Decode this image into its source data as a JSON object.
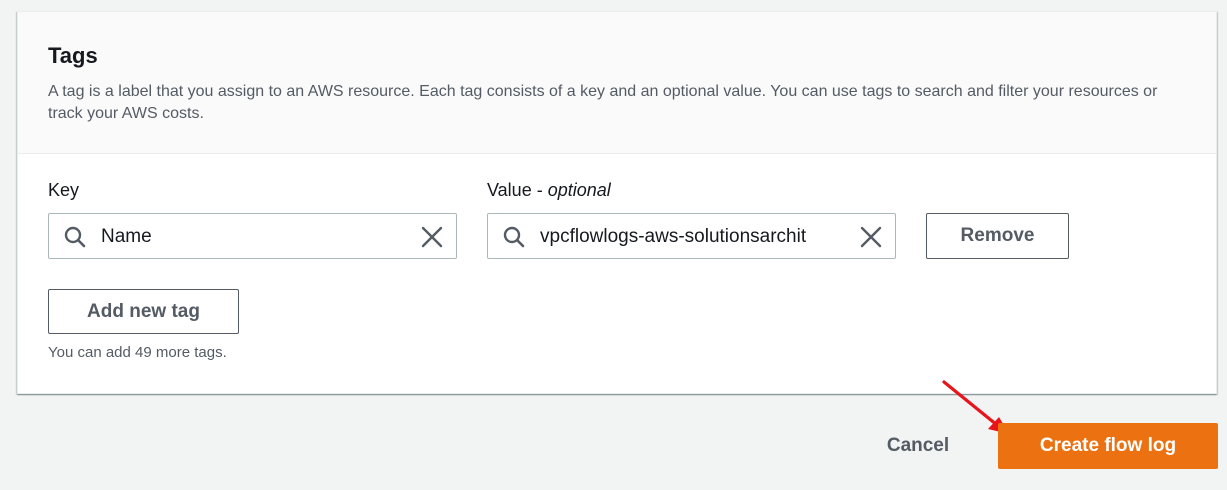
{
  "tags_section": {
    "title": "Tags",
    "description": "A tag is a label that you assign to an AWS resource. Each tag consists of a key and an optional value. You can use tags to search and filter your resources or track your AWS costs."
  },
  "tag_row": {
    "key_label": "Key",
    "value_label_main": "Value - ",
    "value_label_optional": "optional",
    "key_value": "Name",
    "value_value": "vpcflowlogs-aws-solutionsarchit",
    "remove_label": "Remove"
  },
  "add_tag": {
    "label": "Add new tag",
    "hint": "You can add 49 more tags."
  },
  "footer": {
    "cancel_label": "Cancel",
    "create_label": "Create flow log"
  },
  "colors": {
    "primary": "#ec7211",
    "annotation_arrow": "#e8141a"
  }
}
